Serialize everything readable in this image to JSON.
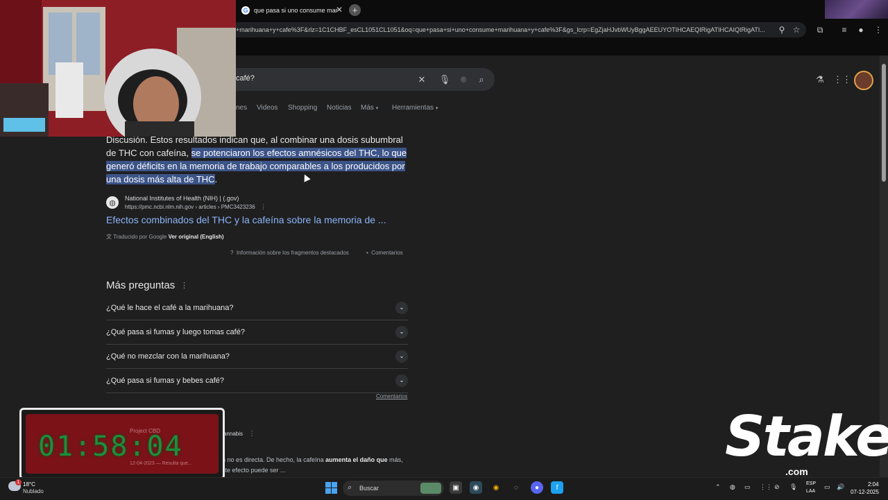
{
  "browser": {
    "tab_title": "que pasa si uno consume mar",
    "url": "+marihuana+y+cafe%3F&rlz=1C1CHBF_esCL1051CL1051&oq=que+pasa+si+uno+consume+marihuana+y+cafe%3F&gs_lcrp=EgZjaHJvbWUyBggAEEUYOTIHCAEQIRigATIHCAIQIRigATI...",
    "new_tab_symbol": "+",
    "close_symbol": "✕"
  },
  "search": {
    "query_visible": "café?",
    "nav_tabs": [
      {
        "label": "nes"
      },
      {
        "label": "Videos"
      },
      {
        "label": "Shopping"
      },
      {
        "label": "Noticias"
      },
      {
        "label": "Más"
      },
      {
        "label": "Herramientas"
      }
    ]
  },
  "featured_snippet": {
    "text_start": "Discusión. Estos resultados indican que, al combinar una dosis subumbral de THC con cafeína, ",
    "text_highlight": "se potenciaron los efectos amnésicos del THC, lo que generó déficits en la memoria de trabajo comparables a los producidos por una dosis más alta de THC",
    "text_end": ".",
    "source_name": "National Institutes of Health (NIH) | (.gov)",
    "source_url": "https://pmc.ncbi.nlm.nih.gov › articles › PMC3423236",
    "link_title": "Efectos combinados del THC y la cafeína sobre la memoria de ...",
    "translated_by": "Traducido por Google",
    "view_original": "Ver original (English)",
    "snippet_info": "Información sobre los fragmentos destacados",
    "comments": "Comentarios"
  },
  "people_also_ask": {
    "title": "Más preguntas",
    "questions": [
      "¿Qué le hace el café a la marihuana?",
      "¿Qué pasa si fumas y luego tomas café?",
      "¿Qué no mezclar con la marihuana?",
      "¿Qué pasa si fumas y bebes café?"
    ],
    "comments": "Comentarios"
  },
  "second_result": {
    "source_name": "cannabis",
    "snippet_start": "on no es directa. De hecho, la cafeína ",
    "snippet_bold": "aumenta el daño que",
    "snippet_end": " más, este efecto puede ser ..."
  },
  "timer_overlay": {
    "digits": "01:58:04",
    "sub1": "Project CBD",
    "sub2": "12-04-2023 — Resulta que..."
  },
  "stake": {
    "logo": "Stake",
    "domain": ".com"
  },
  "taskbar": {
    "weather_badge": "1",
    "temperature": "18°C",
    "condition": "Nublado",
    "search_label": "Buscar",
    "lang1": "ESP",
    "lang2": "LAA",
    "time": "2:04",
    "date": "07-12-2025"
  },
  "colors": {
    "page_bg": "#1f1f1f",
    "link": "#8ab4f8",
    "highlight": "#3c5488",
    "timer_digits": "#1d8f3a"
  }
}
